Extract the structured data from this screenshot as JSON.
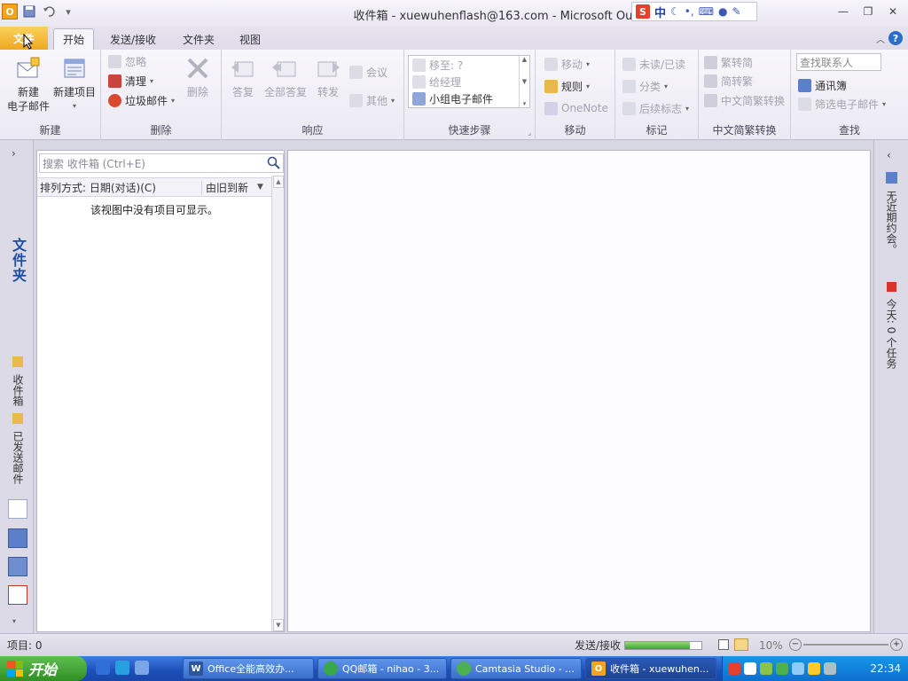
{
  "window": {
    "title": "收件箱 - xuewuhenflash@163.com  -  Microsoft Outlook",
    "ime_mode": "中",
    "ime_s": "S"
  },
  "quick_access": {
    "app_icon": "O",
    "save_icon": "save-icon",
    "undo_icon": "undo-icon",
    "customize_icon": "customize-qat-icon"
  },
  "tabs": {
    "file": "文件",
    "home": "开始",
    "send_receive": "发送/接收",
    "folder": "文件夹",
    "view": "视图"
  },
  "ribbon": {
    "new_group": {
      "label": "新建",
      "new_email_l1": "新建",
      "new_email_l2": "电子邮件",
      "new_items": "新建项目"
    },
    "delete_group": {
      "label": "删除",
      "ignore": "忽略",
      "clean_up": "清理",
      "junk": "垃圾邮件",
      "delete": "删除"
    },
    "respond_group": {
      "label": "响应",
      "reply": "答复",
      "reply_all": "全部答复",
      "forward": "转发",
      "meeting": "会议",
      "more": "其他"
    },
    "quicksteps_group": {
      "label": "快速步骤",
      "move_to": "移至: ?",
      "to_manager": "给经理",
      "team_email": "小组电子邮件"
    },
    "move_group": {
      "label": "移动",
      "move": "移动",
      "rules": "规则",
      "onenote": "OneNote"
    },
    "tags_group": {
      "label": "标记",
      "unread_read": "未读/已读",
      "categorize": "分类",
      "follow_up": "后续标志"
    },
    "chinese_group": {
      "label": "中文简繁转换",
      "to_traditional": "繁转简",
      "to_simplified": "简转繁",
      "conversion": "中文简繁转换"
    },
    "find_group": {
      "label": "查找",
      "search_contacts_placeholder": "查找联系人",
      "address_book": "通讯簿",
      "filter_email": "筛选电子邮件"
    }
  },
  "nav": {
    "title": "文件夹",
    "inbox": "收件箱",
    "sent": "已发送邮件"
  },
  "message_list": {
    "search_placeholder": "搜索 收件箱 (Ctrl+E)",
    "sort_by": "排列方式: 日期(对话)(C)",
    "order": "由旧到新",
    "empty_text": "该视图中没有项目可显示。"
  },
  "todo_bar": {
    "no_appointments": "无近期约会。",
    "tasks_today": "今天: 0 个任务"
  },
  "status": {
    "items": "项目: 0",
    "send_receive": "发送/接收",
    "zoom": "10%",
    "progress": 0.85
  },
  "taskbar": {
    "start": "开始",
    "buttons": [
      "Office全能高效办...",
      "QQ邮箱 - nihao - 3...",
      "Camtasia Studio - ...",
      "收件箱 - xuewuhen..."
    ],
    "clock": "22:34"
  }
}
